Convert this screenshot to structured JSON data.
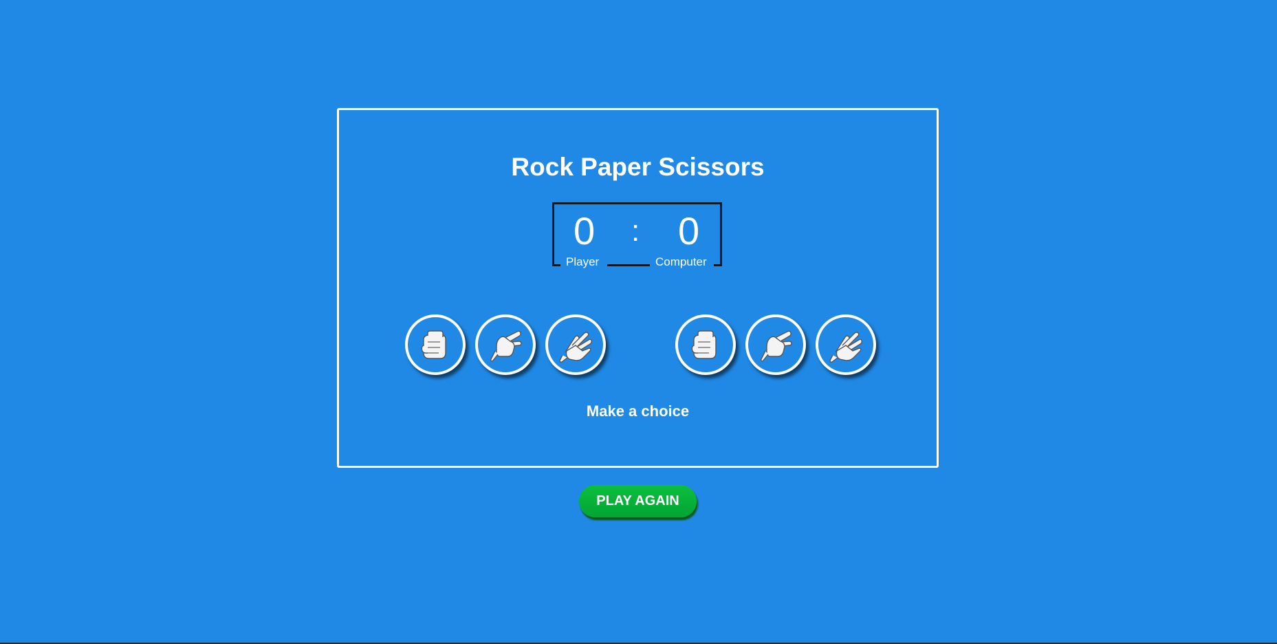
{
  "game": {
    "title": "Rock Paper Scissors",
    "message": "Make a choice"
  },
  "score": {
    "player": "0",
    "computer": "0",
    "separator": ":",
    "player_label": "Player",
    "computer_label": "Computer"
  },
  "player_choices": [
    {
      "icon": "hand-rock-icon"
    },
    {
      "icon": "hand-scissors-icon"
    },
    {
      "icon": "hand-paper-icon"
    }
  ],
  "computer_choices": [
    {
      "icon": "hand-rock-icon"
    },
    {
      "icon": "hand-scissors-icon"
    },
    {
      "icon": "hand-paper-icon"
    }
  ],
  "play_again_label": "PLAY AGAIN",
  "colors": {
    "background": "#1f89e5",
    "button": "#04a433",
    "scoreboard_border": "#111a24"
  }
}
